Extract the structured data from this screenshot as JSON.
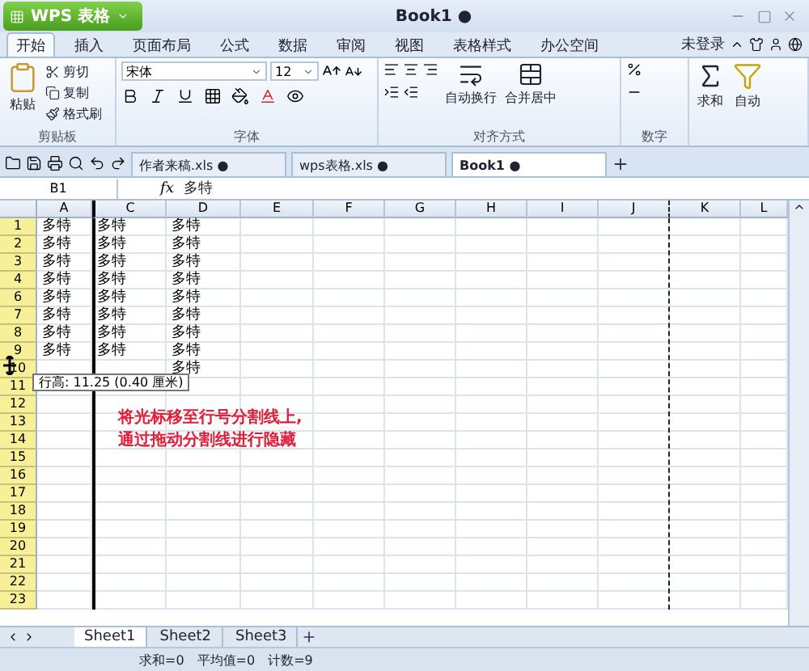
{
  "app_button": {
    "label": "WPS 表格"
  },
  "window": {
    "title": "Book1 ●"
  },
  "ribbon_tabs": [
    {
      "label": "开始",
      "selected": true
    },
    {
      "label": "插入",
      "selected": false
    },
    {
      "label": "页面布局",
      "selected": false
    },
    {
      "label": "公式",
      "selected": false
    },
    {
      "label": "数据",
      "selected": false
    },
    {
      "label": "审阅",
      "selected": false
    },
    {
      "label": "视图",
      "selected": false
    },
    {
      "label": "表格样式",
      "selected": false
    },
    {
      "label": "办公空间",
      "selected": false
    }
  ],
  "account": {
    "label": "未登录"
  },
  "ribbon": {
    "groups": [
      {
        "kind": "clipboard",
        "label": "剪贴板",
        "buttons": [
          {
            "label": "粘贴"
          },
          {
            "label": "剪切"
          },
          {
            "label": "复制"
          },
          {
            "label": "格式刷"
          }
        ]
      },
      {
        "kind": "font",
        "label": "字体",
        "font": "宋体",
        "size": "12"
      },
      {
        "kind": "align",
        "label": "对齐方式",
        "buttons": [
          {
            "label": "自动换行"
          },
          {
            "label": "合并居中"
          }
        ]
      },
      {
        "kind": "number",
        "label": "数字"
      },
      {
        "kind": "tools",
        "buttons": [
          {
            "label": "求和"
          },
          {
            "label": "自动"
          }
        ]
      }
    ]
  },
  "doc_tabs": [
    {
      "label": "作者来稿.xls ●",
      "selected": false
    },
    {
      "label": "wps表格.xls ●",
      "selected": false
    },
    {
      "label": "Book1 ●",
      "selected": true
    }
  ],
  "formula_bar": {
    "cell": "B1",
    "fx": "fx",
    "value": "多特"
  },
  "columns": [
    {
      "label": "A",
      "after_hidden": false,
      "page_break_after": false
    },
    {
      "label": "C",
      "after_hidden": true,
      "page_break_after": false
    },
    {
      "label": "D",
      "after_hidden": false,
      "page_break_after": false
    },
    {
      "label": "E",
      "after_hidden": false,
      "page_break_after": false
    },
    {
      "label": "F",
      "after_hidden": false,
      "page_break_after": false
    },
    {
      "label": "G",
      "after_hidden": false,
      "page_break_after": false
    },
    {
      "label": "H",
      "after_hidden": false,
      "page_break_after": false
    },
    {
      "label": "I",
      "after_hidden": false,
      "page_break_after": false
    },
    {
      "label": "J",
      "after_hidden": false,
      "page_break_after": true
    },
    {
      "label": "K",
      "after_hidden": false,
      "page_break_after": false
    },
    {
      "label": "L",
      "after_hidden": false,
      "page_break_after": false
    }
  ],
  "rows": [
    {
      "header": "1",
      "cells": [
        "多特",
        "多特",
        "多特"
      ]
    },
    {
      "header": "2",
      "cells": [
        "多特",
        "多特",
        "多特"
      ]
    },
    {
      "header": "3",
      "cells": [
        "多特",
        "多特",
        "多特"
      ]
    },
    {
      "header": "4",
      "cells": [
        "多特",
        "多特",
        "多特"
      ]
    },
    {
      "header": "6",
      "cells": [
        "多特",
        "多特",
        "多特"
      ]
    },
    {
      "header": "7",
      "cells": [
        "多特",
        "多特",
        "多特"
      ]
    },
    {
      "header": "8",
      "cells": [
        "多特",
        "多特",
        "多特"
      ]
    },
    {
      "header": "9",
      "cells": [
        "多特",
        "多特",
        "多特"
      ]
    },
    {
      "header": "10",
      "cells": [
        null,
        null,
        "多特"
      ]
    },
    {
      "header": "11"
    },
    {
      "header": "12"
    },
    {
      "header": "13"
    },
    {
      "header": "14"
    },
    {
      "header": "15"
    },
    {
      "header": "16"
    },
    {
      "header": "17"
    },
    {
      "header": "18"
    },
    {
      "header": "19"
    },
    {
      "header": "20"
    },
    {
      "header": "21"
    },
    {
      "header": "22"
    },
    {
      "header": "23"
    }
  ],
  "tooltip": {
    "text": "行高: 11.25 (0.40 厘米)"
  },
  "annotation": {
    "lines": [
      "将光标移至行号分割线上,",
      "通过拖动分割线进行隐藏"
    ]
  },
  "sheet_tabs": [
    {
      "label": "Sheet1",
      "selected": true
    },
    {
      "label": "Sheet2",
      "selected": false
    },
    {
      "label": "Sheet3",
      "selected": false
    }
  ],
  "status_bar": {
    "items": [
      "求和=0",
      "平均值=0",
      "计数=9"
    ]
  }
}
